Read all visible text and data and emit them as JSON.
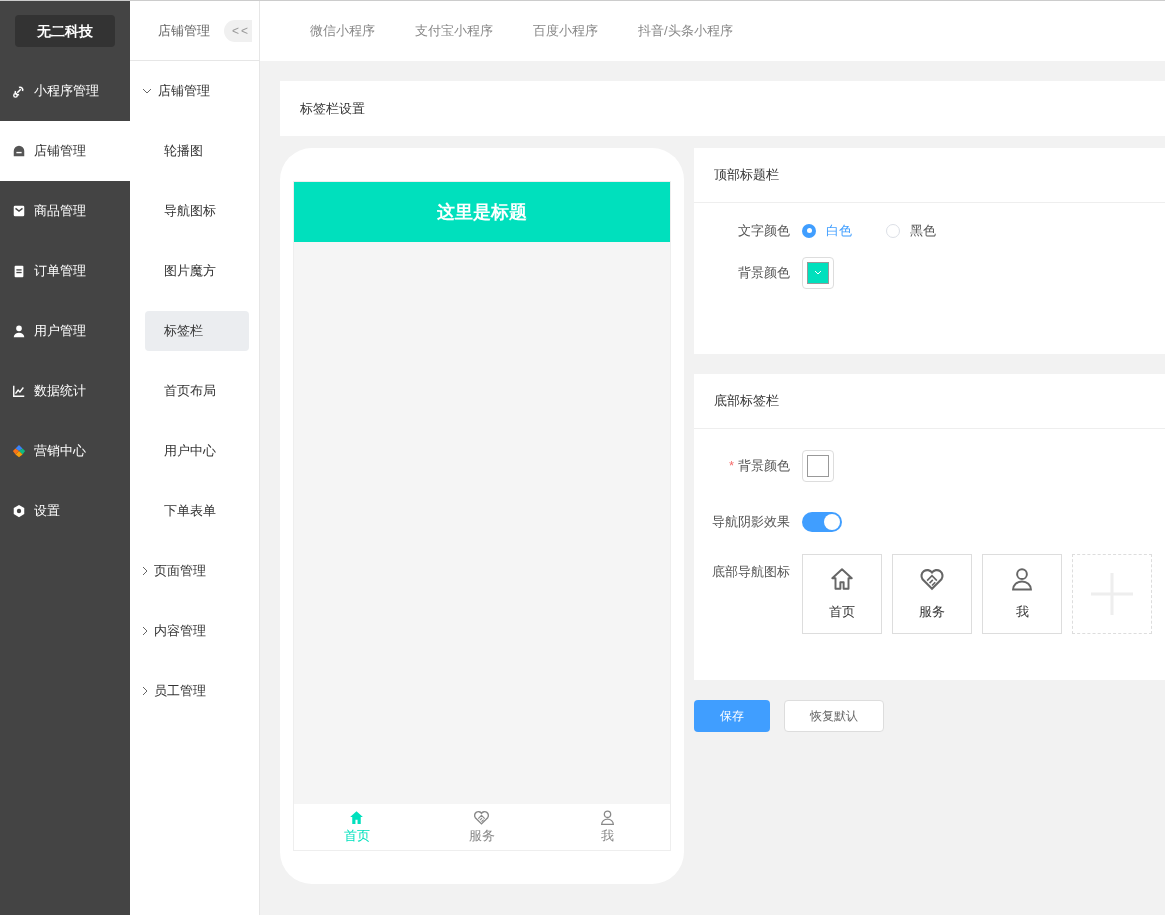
{
  "brand": "无二科技",
  "main_menu": [
    {
      "label": "小程序管理",
      "selected": false
    },
    {
      "label": "店铺管理",
      "selected": true
    },
    {
      "label": "商品管理",
      "selected": false
    },
    {
      "label": "订单管理",
      "selected": false
    },
    {
      "label": "用户管理",
      "selected": false
    },
    {
      "label": "数据统计",
      "selected": false
    },
    {
      "label": "营销中心",
      "selected": false
    },
    {
      "label": "设置",
      "selected": false
    }
  ],
  "sub_header": {
    "title": "店铺管理",
    "collapse": "<<"
  },
  "sub_menu": [
    {
      "label": "店铺管理",
      "expanded": true,
      "children": [
        {
          "label": "轮播图",
          "selected": false
        },
        {
          "label": "导航图标",
          "selected": false
        },
        {
          "label": "图片魔方",
          "selected": false
        },
        {
          "label": "标签栏",
          "selected": true
        },
        {
          "label": "首页布局",
          "selected": false
        },
        {
          "label": "用户中心",
          "selected": false
        },
        {
          "label": "下单表单",
          "selected": false
        }
      ]
    },
    {
      "label": "页面管理",
      "expanded": false
    },
    {
      "label": "内容管理",
      "expanded": false
    },
    {
      "label": "员工管理",
      "expanded": false
    }
  ],
  "top_tabs": [
    "微信小程序",
    "支付宝小程序",
    "百度小程序",
    "抖音/头条小程序"
  ],
  "page_title": "标签栏设置",
  "preview": {
    "title": "这里是标题",
    "tabs": [
      {
        "label": "首页",
        "selected": true
      },
      {
        "label": "服务",
        "selected": false
      },
      {
        "label": "我",
        "selected": false
      }
    ]
  },
  "top_bar_section": {
    "heading": "顶部标题栏",
    "text_color": {
      "label": "文字颜色",
      "options": [
        {
          "label": "白色",
          "selected": true
        },
        {
          "label": "黑色",
          "selected": false
        }
      ]
    },
    "bg_color": {
      "label": "背景颜色",
      "color": "#00e0bd"
    }
  },
  "bottom_bar_section": {
    "heading": "底部标签栏",
    "bg_color": {
      "required_mark": "*",
      "label": "背景颜色",
      "color": "#ffffff"
    },
    "shadow": {
      "label": "导航阴影效果",
      "on": true
    },
    "nav_icons": {
      "label": "底部导航图标",
      "items": [
        {
          "label": "首页"
        },
        {
          "label": "服务"
        },
        {
          "label": "我"
        }
      ]
    }
  },
  "buttons": {
    "save": "保存",
    "reset": "恢复默认"
  }
}
